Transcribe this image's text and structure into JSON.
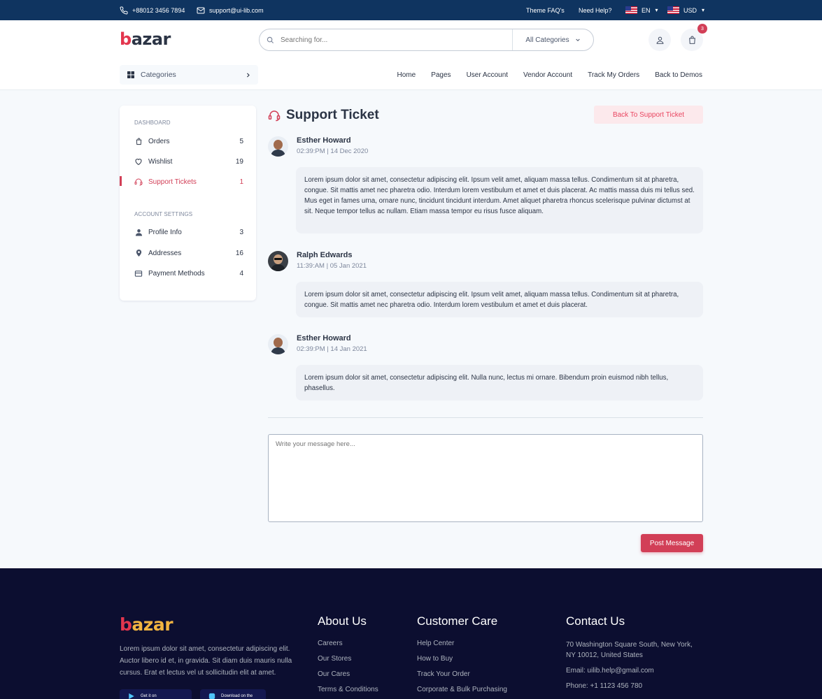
{
  "topbar": {
    "phone": "+88012 3456 7894",
    "email": "support@ui-lib.com",
    "faq": "Theme FAQ's",
    "help": "Need Help?",
    "language": "EN",
    "currency": "USD"
  },
  "header": {
    "logo_first": "b",
    "logo_rest": "azar",
    "search_placeholder": "Searching for...",
    "search_category": "All Categories",
    "cart_count": "3",
    "categories_label": "Categories",
    "nav": [
      "Home",
      "Pages",
      "User Account",
      "Vendor Account",
      "Track My Orders",
      "Back to Demos"
    ]
  },
  "sidebar": {
    "dashboard_title": "DASHBOARD",
    "dashboard_items": [
      {
        "label": "Orders",
        "count": "5",
        "icon": "bag-icon"
      },
      {
        "label": "Wishlist",
        "count": "19",
        "icon": "heart-icon"
      },
      {
        "label": "Support Tickets",
        "count": "1",
        "icon": "headset-icon",
        "active": true
      }
    ],
    "settings_title": "ACCOUNT SETTINGS",
    "settings_items": [
      {
        "label": "Profile Info",
        "count": "3",
        "icon": "person-icon"
      },
      {
        "label": "Addresses",
        "count": "16",
        "icon": "location-pin-icon"
      },
      {
        "label": "Payment Methods",
        "count": "4",
        "icon": "credit-card-icon"
      }
    ]
  },
  "main": {
    "title": "Support Ticket",
    "back_button": "Back To Support Ticket",
    "messages": [
      {
        "name": "Esther Howard",
        "date": "02:39:PM | 14 Dec 2020",
        "text": "Lorem ipsum dolor sit amet, consectetur adipiscing elit. Ipsum velit amet, aliquam massa tellus. Condimentum sit at pharetra, congue. Sit mattis amet nec pharetra odio. Interdum lorem vestibulum et amet et duis placerat. Ac mattis massa duis mi tellus sed. Mus eget in fames urna, ornare nunc, tincidunt tincidunt interdum. Amet aliquet pharetra rhoncus scelerisque pulvinar dictumst at sit. Neque tempor tellus ac nullam. Etiam massa tempor eu risus fusce aliquam."
      },
      {
        "name": "Ralph Edwards",
        "date": "11:39:AM | 05 Jan 2021",
        "text": "Lorem ipsum dolor sit amet, consectetur adipiscing elit. Ipsum velit amet, aliquam massa tellus. Condimentum sit at pharetra, congue. Sit mattis amet nec pharetra odio. Interdum lorem vestibulum et amet et duis placerat."
      },
      {
        "name": "Esther Howard",
        "date": "02:39:PM | 14 Jan 2021",
        "text": "Lorem ipsum dolor sit amet, consectetur adipiscing elit. Nulla nunc, lectus mi ornare. Bibendum proin euismod nibh tellus, phasellus."
      }
    ],
    "message_placeholder": "Write your message here...",
    "post_button": "Post Message"
  },
  "footer": {
    "logo_first": "b",
    "logo_rest": "azar",
    "description": "Lorem ipsum dolor sit amet, consectetur adipiscing elit. Auctor libero id et, in gravida. Sit diam duis mauris nulla cursus. Erat et lectus vel ut sollicitudin elit at amet.",
    "google_play": "Get it on",
    "app_store": "Download on the",
    "about_title": "About Us",
    "about_links": [
      "Careers",
      "Our Stores",
      "Our Cares",
      "Terms & Conditions"
    ],
    "care_title": "Customer Care",
    "care_links": [
      "Help Center",
      "How to Buy",
      "Track Your Order",
      "Corporate & Bulk Purchasing"
    ],
    "contact_title": "Contact Us",
    "contact_address": "70 Washington Square South, New York, NY 10012, United States",
    "contact_email": "Email: uilib.help@gmail.com",
    "contact_phone": "Phone: +1 1123 456 780"
  }
}
